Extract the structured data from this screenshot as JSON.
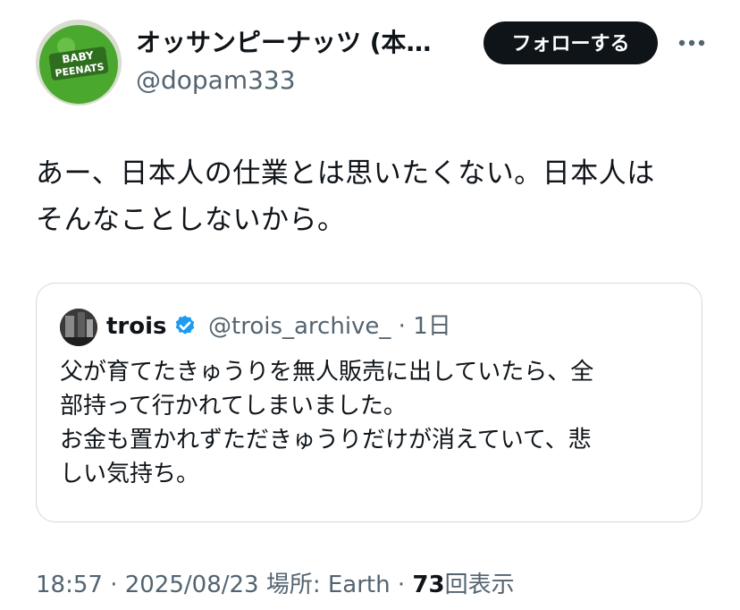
{
  "author": {
    "display_name": "オッサンピーナッツ (本…",
    "handle": "@dopam333",
    "avatar": {
      "label_top": "BABY",
      "label_bottom": "PEENATS",
      "icon": "baby-peenats-logo"
    }
  },
  "actions": {
    "follow_label": "フォローする",
    "more_icon": "more-horizontal-icon"
  },
  "tweet": {
    "lines": [
      "あー、日本人の仕業とは思いたくない。日本人は",
      "そんなことしないから。"
    ]
  },
  "quote": {
    "display_name": "trois",
    "verified_icon": "verified-badge-icon",
    "handle_time": "@trois_archive_ · 1日",
    "lines": [
      "父が育てたきゅうりを無人販売に出していたら、全",
      "部持って行かれてしまいました。",
      "お金も置かれずただきゅうりだけが消えていて、悲",
      "しい気持ち。"
    ]
  },
  "meta": {
    "time_date_location": "18:57 · 2025/08/23 場所: Earth · ",
    "view_count": "73",
    "views_label": "回表示"
  },
  "colors": {
    "text": "#0f1419",
    "secondary": "#536471",
    "border": "#cfd9de",
    "verified": "#1d9bf0",
    "avatar_green": "#4aa82e"
  }
}
